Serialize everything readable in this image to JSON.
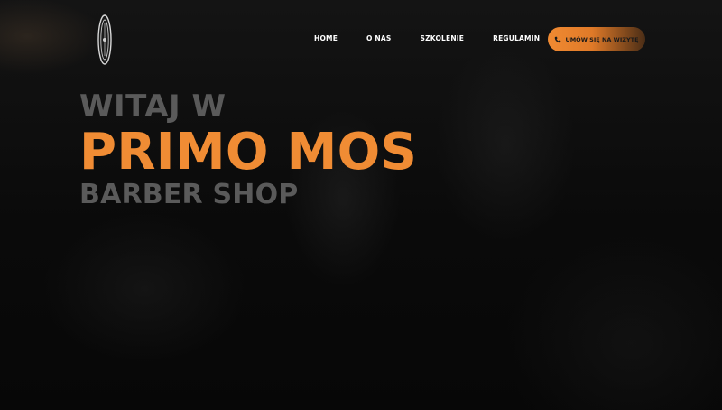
{
  "nav": {
    "items": [
      "HOME",
      "O NAS",
      "SZKOLENIE",
      "REGULAMIN"
    ],
    "cta_label": "UMÓW SIĘ NA WIZYTĘ"
  },
  "hero": {
    "line1": "WITAJ W",
    "line2": "PRIMO MOS",
    "line3": "BARBER SHOP"
  },
  "colors": {
    "accent": "#f08c34",
    "muted_text": "#5a5a5a",
    "background": "#0b0b0b"
  },
  "icons": {
    "logo": "barber-logo-emblem",
    "cta": "phone-icon"
  }
}
